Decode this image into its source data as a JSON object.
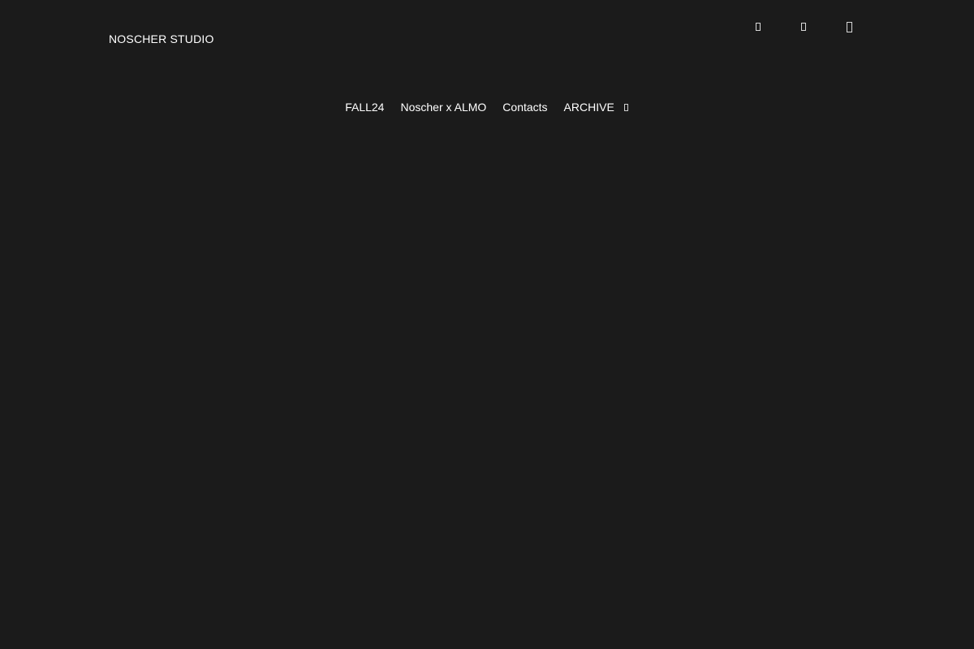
{
  "header": {
    "brand": "NOSCHER STUDIO",
    "icons": [
      {
        "name": "account-icon"
      },
      {
        "name": "search-icon"
      },
      {
        "name": "cart-icon"
      }
    ]
  },
  "nav": {
    "items": [
      {
        "label": "FALL24"
      },
      {
        "label": "Noscher x ALMO"
      },
      {
        "label": "Contacts"
      },
      {
        "label": "ARCHIVE",
        "has_dropdown": true
      }
    ]
  },
  "colors": {
    "background": "#1b1b1b",
    "text": "#ffffff"
  }
}
